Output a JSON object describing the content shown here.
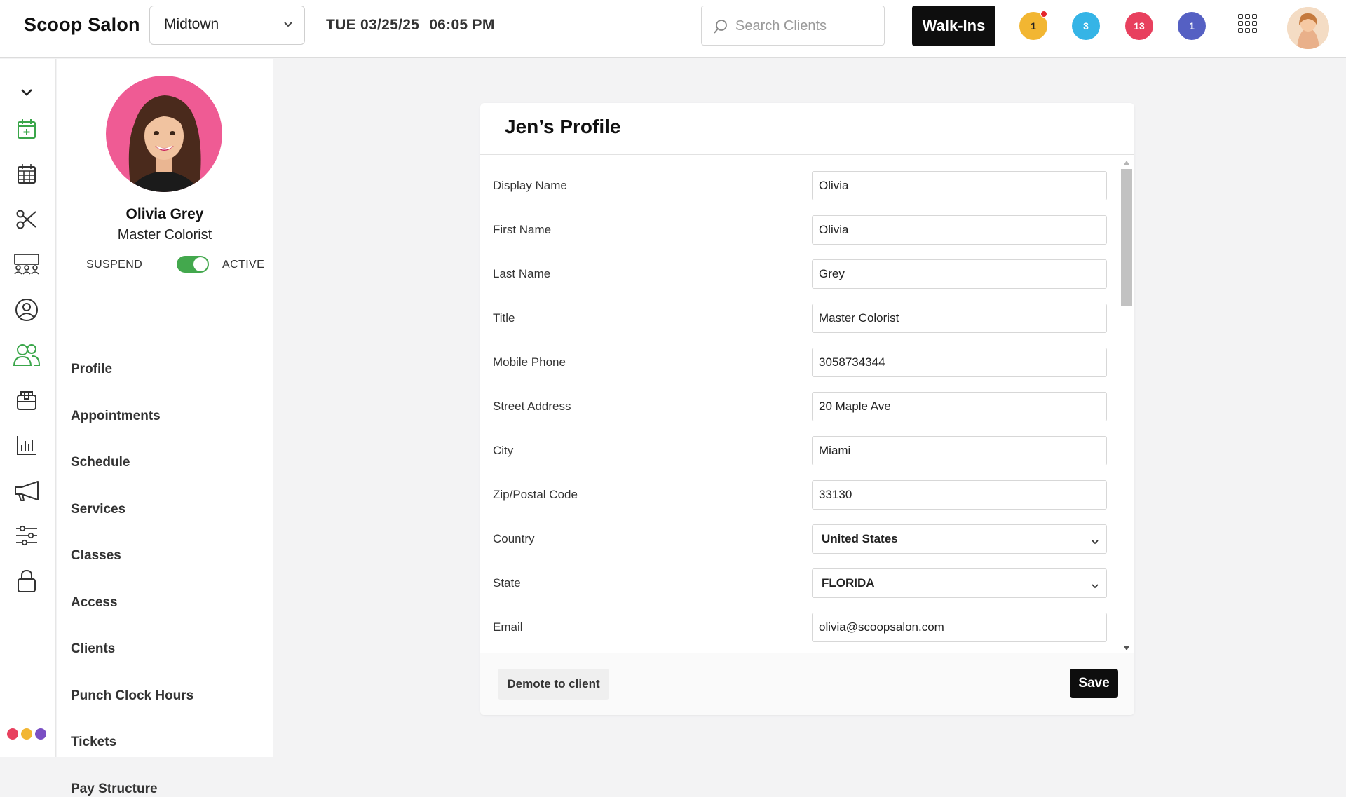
{
  "app": {
    "brand": "Scoop Salon",
    "location": "Midtown",
    "date": "TUE 03/25/25",
    "time": "06:05 PM"
  },
  "search": {
    "placeholder": "Search Clients"
  },
  "walkins_label": "Walk-Ins",
  "badges": [
    {
      "count": "1",
      "color": "#f2b632",
      "text_color": "#222",
      "has_dot": true
    },
    {
      "count": "3",
      "color": "#35b4e6",
      "text_color": "#fff",
      "has_dot": false
    },
    {
      "count": "13",
      "color": "#e8405e",
      "text_color": "#fff",
      "has_dot": false
    },
    {
      "count": "1",
      "color": "#5560c3",
      "text_color": "#fff",
      "has_dot": false
    }
  ],
  "rail": {
    "icons": [
      "chevron-down-icon",
      "calendar-add-icon",
      "calendar-grid-icon",
      "scissors-icon",
      "team-meeting-icon",
      "user-circle-icon",
      "staff-icon",
      "register-icon",
      "bar-chart-icon",
      "megaphone-icon",
      "sliders-icon",
      "lock-icon"
    ],
    "active_icon": "staff-icon",
    "accent_color": "#3aa64a",
    "dots": [
      "#e8405e",
      "#f2b632",
      "#7a4fc4"
    ]
  },
  "profile": {
    "name": "Olivia Grey",
    "title": "Master Colorist",
    "suspend_label": "SUSPEND",
    "active_label": "ACTIVE",
    "is_active": true,
    "menu": [
      "Profile",
      "Appointments",
      "Schedule",
      "Services",
      "Classes",
      "Access",
      "Clients",
      "Punch Clock Hours",
      "Tickets",
      "Pay Structure"
    ]
  },
  "card": {
    "title": "Jen’s Profile",
    "fields": [
      {
        "label": "Display Name",
        "value": "Olivia",
        "type": "text"
      },
      {
        "label": "First Name",
        "value": "Olivia",
        "type": "text"
      },
      {
        "label": "Last Name",
        "value": "Grey",
        "type": "text"
      },
      {
        "label": "Title",
        "value": "Master Colorist",
        "type": "text"
      },
      {
        "label": "Mobile Phone",
        "value": "3058734344",
        "type": "text"
      },
      {
        "label": "Street Address",
        "value": "20 Maple Ave",
        "type": "text"
      },
      {
        "label": "City",
        "value": "Miami",
        "type": "text"
      },
      {
        "label": "Zip/Postal Code",
        "value": "33130",
        "type": "text"
      },
      {
        "label": "Country",
        "value": "United States",
        "type": "select"
      },
      {
        "label": "State",
        "value": "FLORIDA",
        "type": "select"
      },
      {
        "label": "Email",
        "value": "olivia@scoopsalon.com",
        "type": "text"
      }
    ],
    "demote_label": "Demote to client",
    "save_label": "Save"
  }
}
